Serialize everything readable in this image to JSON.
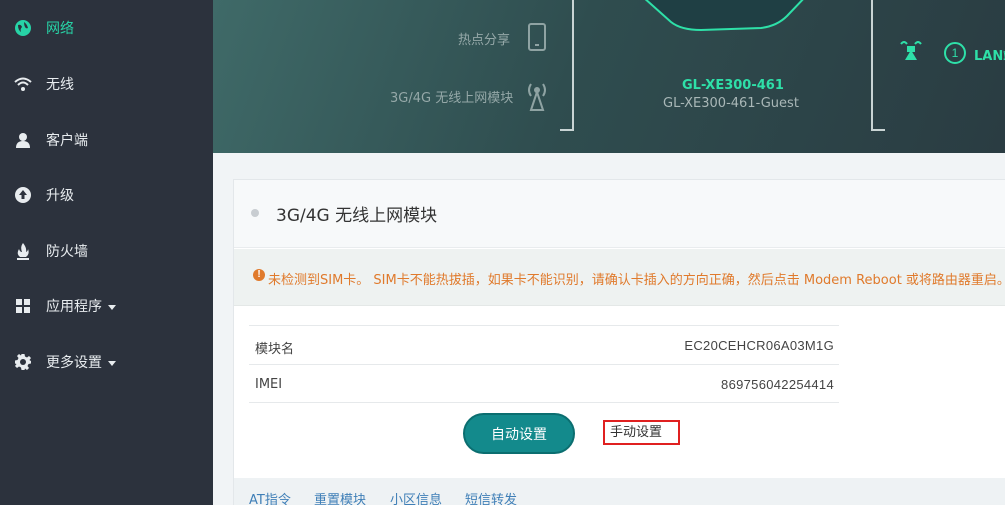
{
  "sidebar": {
    "items": [
      {
        "label": "网络",
        "icon": "globe-icon",
        "active": true
      },
      {
        "label": "无线",
        "icon": "wifi-icon"
      },
      {
        "label": "客户端",
        "icon": "user-icon"
      },
      {
        "label": "升级",
        "icon": "upgrade-icon"
      },
      {
        "label": "防火墙",
        "icon": "fire-icon"
      },
      {
        "label": "应用程序",
        "icon": "grid-icon",
        "dropdown": true
      },
      {
        "label": "更多设置",
        "icon": "gear-icon",
        "dropdown": true
      }
    ]
  },
  "banner": {
    "hotspot_label": "热点分享",
    "modem_label": "3G/4G 无线上网模块",
    "device_name": "GL-XE300-461",
    "device_guest": "GL-XE300-461-Guest",
    "lan_number": "1",
    "lan_label": "LAN端"
  },
  "card": {
    "title": "3G/4G 无线上网模块",
    "alert_icon": "!",
    "alert": "未检测到SIM卡。 SIM卡不能热拔插，如果卡不能识别，请确认卡插入的方向正确，然后点击 Modem Reboot 或将路由器重启。",
    "rows": [
      {
        "key": "模块名",
        "value": "EC20CEHCR06A03M1G"
      },
      {
        "key": "IMEI",
        "value": "869756042254414"
      }
    ],
    "auto_button": "自动设置",
    "manual_link": "手动设置",
    "footer_links": [
      "AT指令",
      "重置模块",
      "小区信息",
      "短信转发"
    ]
  },
  "colors": {
    "accent": "#27d3a6",
    "button": "#138a8c",
    "alert": "#e07a2c",
    "link": "#3f7fb7",
    "sidebar_bg": "#2c323d"
  }
}
